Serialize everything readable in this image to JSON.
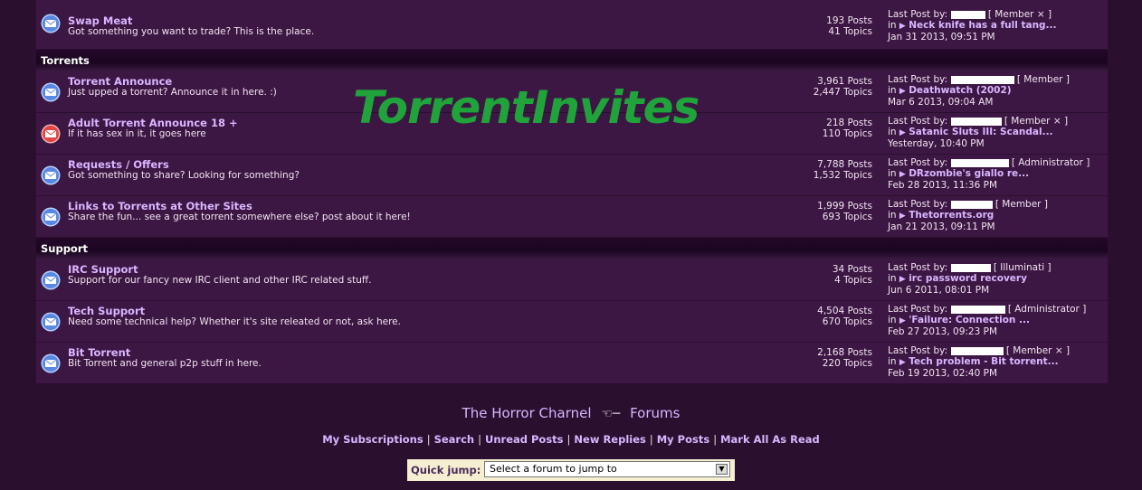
{
  "categories": [
    {
      "name": "",
      "forums": [
        {
          "title": "Swap Meat",
          "desc": "Got something you want to trade? This is the place.",
          "posts": "193 Posts",
          "topics": "41 Topics",
          "last_by_label": "Last Post by:",
          "rank": "[ Member × ]",
          "in_label": "in",
          "topic": "Neck knife has a full tang...",
          "date": "Jan 31 2013, 09:51 PM",
          "icon": "envelope-icon"
        }
      ]
    },
    {
      "name": "Torrents",
      "forums": [
        {
          "title": "Torrent Announce",
          "desc": "Just upped a torrent? Announce it in here. :)",
          "posts": "3,961 Posts",
          "topics": "2,447 Topics",
          "last_by_label": "Last Post by:",
          "rank": "[ Member ]",
          "in_label": "in",
          "topic": "Deathwatch (2002)",
          "date": "Mar 6 2013, 09:04 AM",
          "icon": "envelope-icon"
        },
        {
          "title": "Adult Torrent Announce 18 +",
          "desc": "If it has sex in it, it goes here",
          "posts": "218 Posts",
          "topics": "110 Topics",
          "last_by_label": "Last Post by:",
          "rank": "[ Member × ]",
          "in_label": "in",
          "topic": "Satanic Sluts III: Scandal...",
          "date": "Yesterday, 10:40 PM",
          "icon": "envelope-red-icon"
        },
        {
          "title": "Requests / Offers",
          "desc": "Got something to share? Looking for something?",
          "posts": "7,788 Posts",
          "topics": "1,532 Topics",
          "last_by_label": "Last Post by:",
          "rank": "[ Administrator ]",
          "in_label": "in",
          "topic": "DRzombie's giallo re...",
          "date": "Feb 28 2013, 11:36 PM",
          "icon": "envelope-icon"
        },
        {
          "title": "Links to Torrents at Other Sites",
          "desc": "Share the fun... see a great torrent somewhere else? post about it here!",
          "posts": "1,999 Posts",
          "topics": "693 Topics",
          "last_by_label": "Last Post by:",
          "rank": "[ Member ]",
          "in_label": "in",
          "topic": "Thetorrents.org",
          "date": "Jan 21 2013, 09:11 PM",
          "icon": "envelope-icon"
        }
      ]
    },
    {
      "name": "Support",
      "forums": [
        {
          "title": "IRC Support",
          "desc": "Support for our fancy new IRC client and other IRC related stuff.",
          "posts": "34 Posts",
          "topics": "4 Topics",
          "last_by_label": "Last Post by:",
          "rank": "[ Illuminati ]",
          "in_label": "in",
          "topic": "irc password recovery",
          "date": "Jun 6 2011, 08:01 PM",
          "icon": "envelope-icon"
        },
        {
          "title": "Tech Support",
          "desc": "Need some technical help? Whether it's site releated or not, ask here.",
          "posts": "4,504 Posts",
          "topics": "670 Topics",
          "last_by_label": "Last Post by:",
          "rank": "[ Administrator ]",
          "in_label": "in",
          "topic": "'Failure: Connection ...",
          "date": "Feb 27 2013, 09:23 PM",
          "icon": "envelope-icon"
        },
        {
          "title": "Bit Torrent",
          "desc": "Bit Torrent and general p2p stuff in here.",
          "posts": "2,168 Posts",
          "topics": "220 Topics",
          "last_by_label": "Last Post by:",
          "rank": "[ Member × ]",
          "in_label": "in",
          "topic": "Tech problem - Bit torrent...",
          "date": "Feb 19 2013, 02:40 PM",
          "icon": "envelope-icon"
        }
      ]
    }
  ],
  "watermark": "TorrentInvites",
  "footer": {
    "site_name": "The Horror Charnel",
    "forums_label": "Forums",
    "links": [
      "My Subscriptions",
      "Search",
      "Unread Posts",
      "New Replies",
      "My Posts",
      "Mark All As Read"
    ],
    "separator": "|",
    "quick_jump_label": "Quick jump:",
    "quick_jump_value": "Select a forum to jump to"
  },
  "colors": {
    "link": "#d9b6ff",
    "row_bg": "#3d1744",
    "page_bg": "#2a0f2f",
    "watermark": "#1fa33a"
  }
}
